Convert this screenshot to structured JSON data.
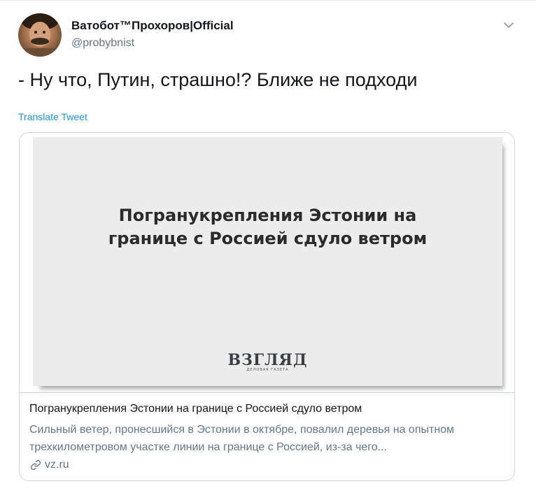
{
  "author": {
    "display_name": "Ватобот™Прохоров|Official",
    "handle": "@probybnist",
    "avatar_icon": "user-avatar"
  },
  "tweet": {
    "text": "- Ну что, Путин, страшно!? Ближе не подходи",
    "translate_label": "Translate Tweet",
    "menu_icon": "chevron-down-icon"
  },
  "card": {
    "image_headline_line1": "Погранукрепления Эстонии на",
    "image_headline_line2": "границе с Россией сдуло ветром",
    "image_logo": "ВЗГЛЯД",
    "image_logo_sub": "ДЕЛОВАЯ ГАЗЕТА",
    "title": "Погранукрепления Эстонии на границе с Россией сдуло ветром",
    "description": "Сильный ветер, пронесшийся в Эстонии в октябре, повалил деревья на опытном трехкилометровом участке линии на границе с Россией, из-за чего...",
    "domain": "vz.ru",
    "link_icon": "link-icon"
  },
  "colors": {
    "link_blue": "#1b95e0",
    "secondary_text": "#657786",
    "border": "#ccd6dd"
  }
}
